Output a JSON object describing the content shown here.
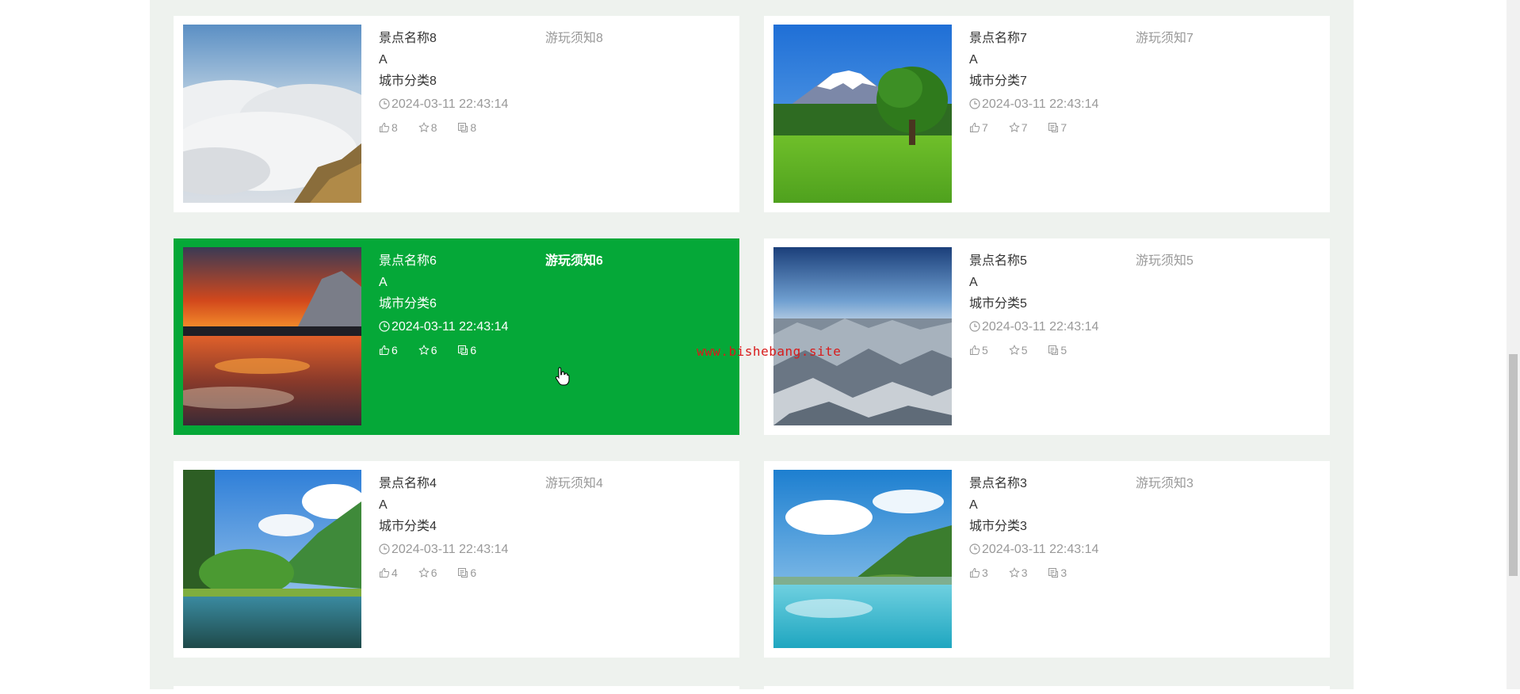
{
  "spots": [
    {
      "name": "景点名称8",
      "notice": "游玩须知8",
      "grade": "A",
      "city": "城市分类8",
      "time": "2024-03-11 22:43:14",
      "likes": "8",
      "favorites": "8",
      "comments": "8",
      "scene": "clouds"
    },
    {
      "name": "景点名称7",
      "notice": "游玩须知7",
      "grade": "A",
      "city": "城市分类7",
      "time": "2024-03-11 22:43:14",
      "likes": "7",
      "favorites": "7",
      "comments": "7",
      "scene": "fuji"
    },
    {
      "name": "景点名称6",
      "notice": "游玩须知6",
      "grade": "A",
      "city": "城市分类6",
      "time": "2024-03-11 22:43:14",
      "likes": "6",
      "favorites": "6",
      "comments": "6",
      "scene": "sunset",
      "active": true
    },
    {
      "name": "景点名称5",
      "notice": "游玩须知5",
      "grade": "A",
      "city": "城市分类5",
      "time": "2024-03-11 22:43:14",
      "likes": "5",
      "favorites": "5",
      "comments": "5",
      "scene": "mountains"
    },
    {
      "name": "景点名称4",
      "notice": "游玩须知4",
      "grade": "A",
      "city": "城市分类4",
      "time": "2024-03-11 22:43:14",
      "likes": "4",
      "favorites": "6",
      "comments": "6",
      "scene": "lake"
    },
    {
      "name": "景点名称3",
      "notice": "游玩须知3",
      "grade": "A",
      "city": "城市分类3",
      "time": "2024-03-11 22:43:14",
      "likes": "3",
      "favorites": "3",
      "comments": "3",
      "scene": "turquoise"
    }
  ],
  "watermark": "www.bishebang.site",
  "colors": {
    "active_card": "#05a838",
    "page_bg": "#eef2ee",
    "watermark": "#d81b1b"
  },
  "icons": {
    "like": "thumbs-up-icon",
    "favorite": "star-icon",
    "comment": "comment-icon",
    "time": "clock-icon"
  }
}
